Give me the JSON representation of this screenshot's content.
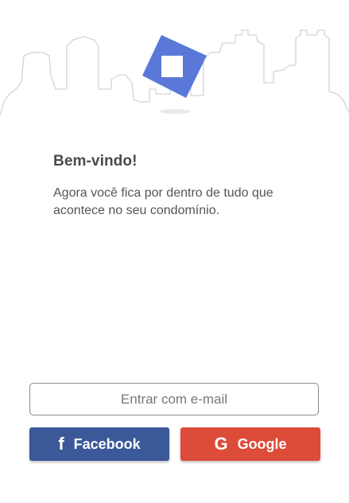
{
  "colors": {
    "logo": "#5a78d8",
    "skyline": "#d4d4d4",
    "facebook": "#3b5998",
    "google": "#dd4b39"
  },
  "welcome": {
    "title": "Bem-vindo!",
    "subtitle": "Agora você fica por dentro de tudo que acontece no seu condomínio."
  },
  "actions": {
    "email_label": "Entrar com e-mail",
    "facebook_label": "Facebook",
    "facebook_icon": "f",
    "google_label": "Google",
    "google_icon": "G"
  }
}
